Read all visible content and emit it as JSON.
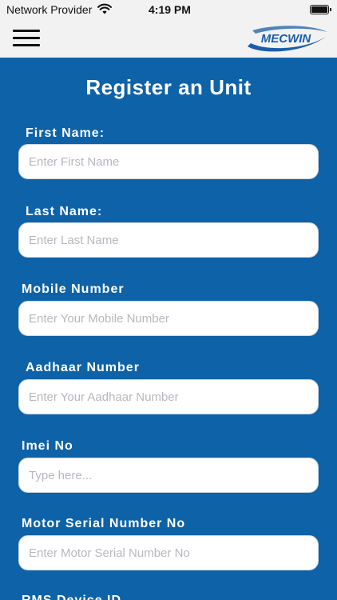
{
  "status_bar": {
    "carrier": "Network Provider",
    "time": "4:19 PM"
  },
  "nav": {
    "logo_text": "MECWIN"
  },
  "form": {
    "title": "Register an Unit",
    "fields": [
      {
        "label": "First Name:",
        "placeholder": "Enter First Name"
      },
      {
        "label": "Last Name:",
        "placeholder": "Enter Last Name"
      },
      {
        "label": "Mobile Number",
        "placeholder": "Enter Your Mobile Number"
      },
      {
        "label": "Aadhaar Number",
        "placeholder": "Enter Your Aadhaar Number"
      },
      {
        "label": "Imei No",
        "placeholder": "Type here..."
      },
      {
        "label": "Motor Serial Number No",
        "placeholder": "Enter Motor Serial Number No"
      },
      {
        "label": "RMS Device ID"
      }
    ]
  },
  "colors": {
    "background": "#0e62a8",
    "bar": "#f2f2f2",
    "input_bg": "#ffffff",
    "placeholder": "#b7b7bf",
    "logo_blue": "#1a5ea8"
  },
  "icons": {
    "menu": "hamburger-menu-icon",
    "wifi": "wifi-icon",
    "battery": "battery-icon"
  }
}
